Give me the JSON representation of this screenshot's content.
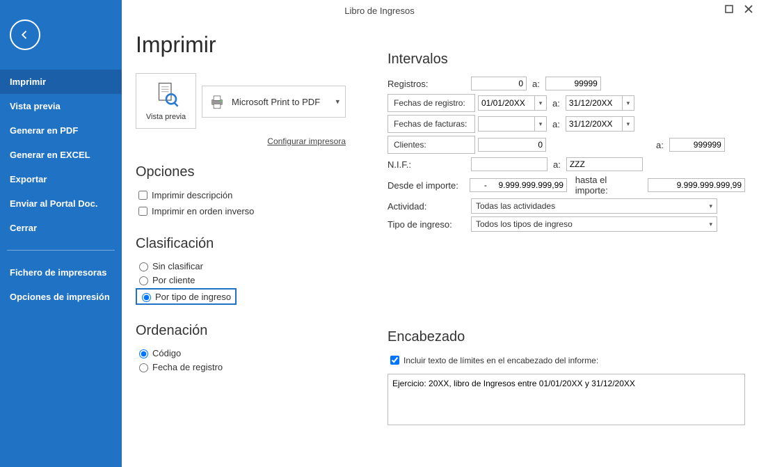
{
  "title": "Libro de Ingresos",
  "sidebar": {
    "items": [
      {
        "label": "Imprimir"
      },
      {
        "label": "Vista previa"
      },
      {
        "label": "Generar en PDF"
      },
      {
        "label": "Generar en EXCEL"
      },
      {
        "label": "Exportar"
      },
      {
        "label": "Enviar al Portal Doc."
      },
      {
        "label": "Cerrar"
      }
    ],
    "secondary": [
      {
        "label": "Fichero de impresoras"
      },
      {
        "label": "Opciones de impresión"
      }
    ]
  },
  "page": {
    "heading": "Imprimir",
    "preview": "Vista previa",
    "printer": "Microsoft Print to PDF",
    "config_link": "Configurar impresora"
  },
  "opciones": {
    "heading": "Opciones",
    "desc": "Imprimir descripción",
    "rev": "Imprimir en orden inverso"
  },
  "clasif": {
    "heading": "Clasificación",
    "sin": "Sin clasificar",
    "cliente": "Por cliente",
    "tipo": "Por tipo de ingreso"
  },
  "orden": {
    "heading": "Ordenación",
    "codigo": "Código",
    "fecha": "Fecha de registro"
  },
  "interv": {
    "heading": "Intervalos",
    "a": "a:",
    "registros_lbl": "Registros:",
    "registros_from": "0",
    "registros_to": "99999",
    "freg_btn": "Fechas de registro:",
    "freg_from": "01/01/20XX",
    "freg_to": "31/12/20XX",
    "ffac_btn": "Fechas de facturas:",
    "ffac_from": "",
    "ffac_to": "31/12/20XX",
    "clientes_btn": "Clientes:",
    "clientes_from": "0",
    "clientes_to": "999999",
    "nif_lbl": "N.I.F.:",
    "nif_from": "",
    "nif_to": "ZZZ",
    "imp_from_lbl": "Desde el importe:",
    "imp_from": "-     9.999.999.999,99",
    "imp_to_lbl": "hasta el importe:",
    "imp_to": "9.999.999.999,99",
    "act_lbl": "Actividad:",
    "act_val": "Todas las actividades",
    "ting_lbl": "Tipo de ingreso:",
    "ting_val": "Todos los tipos de ingreso"
  },
  "encab": {
    "heading": "Encabezado",
    "chk": "Incluir texto de límites en el encabezado del informe:",
    "text": "Ejercicio: 20XX, libro de Ingresos entre 01/01/20XX y 31/12/20XX"
  }
}
